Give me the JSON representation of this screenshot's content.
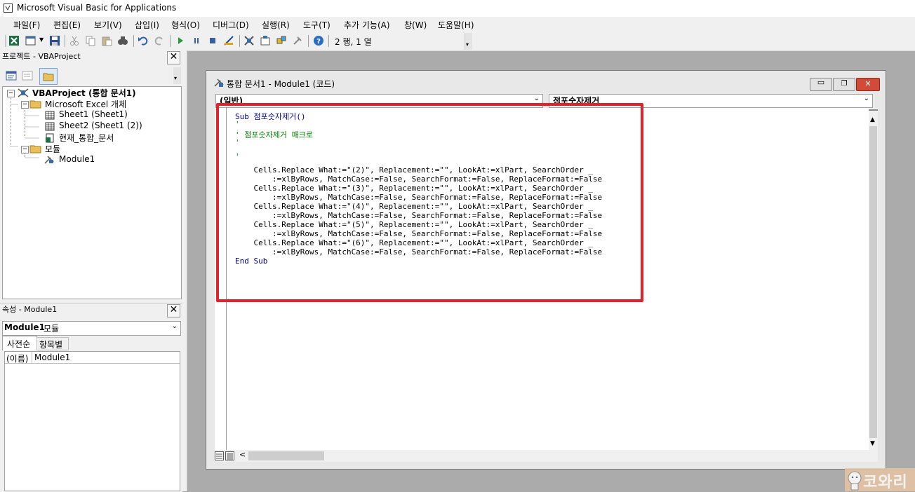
{
  "window": {
    "title": "Microsoft Visual Basic for Applications"
  },
  "menu": [
    "파일(F)",
    "편집(E)",
    "보기(V)",
    "삽입(I)",
    "형식(O)",
    "디버그(D)",
    "실행(R)",
    "도구(T)",
    "추가 기능(A)",
    "창(W)",
    "도움말(H)"
  ],
  "toolbar": {
    "position": "2 행, 1 열"
  },
  "project": {
    "title": "프로젝트 - VBAProject",
    "root": "VBAProject (통합 문서1)",
    "folder_excel": "Microsoft Excel 개체",
    "sheet1": "Sheet1 (Sheet1)",
    "sheet2": "Sheet2 (Sheet1 (2))",
    "thisworkbook": "현재_통합_문서",
    "folder_modules": "모듈",
    "module1": "Module1"
  },
  "properties": {
    "title": "속성 - Module1",
    "combo_bold": "Module1",
    "combo_rest": " 모듈",
    "tab_alpha": "사전순",
    "tab_category": "항목별",
    "row_name": "(이름)",
    "row_value": "Module1"
  },
  "codewin": {
    "title": "통합 문서1 - Module1 (코드)",
    "object_combo": "(일반)",
    "proc_combo": "점포숫자제거"
  },
  "code": [
    "Sub 점포숫자제거()",
    "'",
    "' 점포숫자제거 매크로",
    "'",
    "",
    "'",
    "    Cells.Replace What:=\"(2)\", Replacement:=\"\", LookAt:=xlPart, SearchOrder _",
    "        :=xlByRows, MatchCase:=False, SearchFormat:=False, ReplaceFormat:=False",
    "    Cells.Replace What:=\"(3)\", Replacement:=\"\", LookAt:=xlPart, SearchOrder _",
    "        :=xlByRows, MatchCase:=False, SearchFormat:=False, ReplaceFormat:=False",
    "    Cells.Replace What:=\"(4)\", Replacement:=\"\", LookAt:=xlPart, SearchOrder _",
    "        :=xlByRows, MatchCase:=False, SearchFormat:=False, ReplaceFormat:=False",
    "    Cells.Replace What:=\"(5)\", Replacement:=\"\", LookAt:=xlPart, SearchOrder _",
    "        :=xlByRows, MatchCase:=False, SearchFormat:=False, ReplaceFormat:=False",
    "    Cells.Replace What:=\"(6)\", Replacement:=\"\", LookAt:=xlPart, SearchOrder _",
    "        :=xlByRows, MatchCase:=False, SearchFormat:=False, ReplaceFormat:=False",
    "End Sub"
  ],
  "watermark": "코와리",
  "colors": {
    "comment": "#008000",
    "highlight": "#e3212b",
    "keyword": "#00008b"
  }
}
